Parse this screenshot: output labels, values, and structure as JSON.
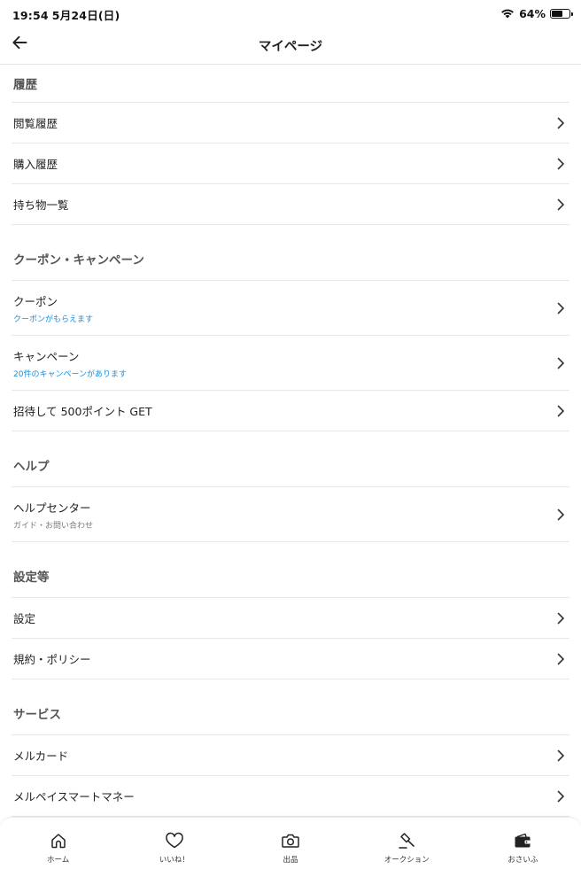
{
  "status_bar": {
    "time": "19:54",
    "date": "5月24日(日)",
    "battery_text": "64%",
    "battery_level": 0.64
  },
  "nav": {
    "title": "マイページ",
    "back_icon": "arrow-left-icon"
  },
  "sections": {
    "history": {
      "title": "履歴",
      "items": [
        "閲覧履歴",
        "購入履歴",
        "持ち物一覧"
      ]
    },
    "coupon": {
      "title": "クーポン・キャンペーン",
      "items": [
        {
          "label": "クーポン",
          "sub": "クーポンがもらえます"
        },
        {
          "label": "キャンペーン",
          "sub": "20件のキャンペーンがあります"
        },
        {
          "label": "招待して 500ポイント GET"
        }
      ]
    },
    "help": {
      "title": "ヘルプ",
      "items": [
        {
          "label": "ヘルプセンター",
          "sub": "ガイド・お問い合わせ"
        }
      ]
    },
    "settings": {
      "title": "設定等",
      "items": [
        "設定",
        "規約・ポリシー"
      ]
    },
    "services": {
      "title": "サービス",
      "items": [
        "メルカード",
        "メルペイスマートマネー"
      ]
    }
  },
  "tab_bar": {
    "tabs": [
      {
        "label": "ホーム",
        "icon": "home-icon"
      },
      {
        "label": "いいね！",
        "icon": "heart-icon"
      },
      {
        "label": "出品",
        "icon": "camera-icon"
      },
      {
        "label": "オークション",
        "icon": "gavel-icon"
      },
      {
        "label": "おさいふ",
        "icon": "wallet-icon"
      }
    ]
  },
  "colors": {
    "accent_blue": "#1a8fe0",
    "divider": "#e8e8e8",
    "section_title": "#555555"
  }
}
